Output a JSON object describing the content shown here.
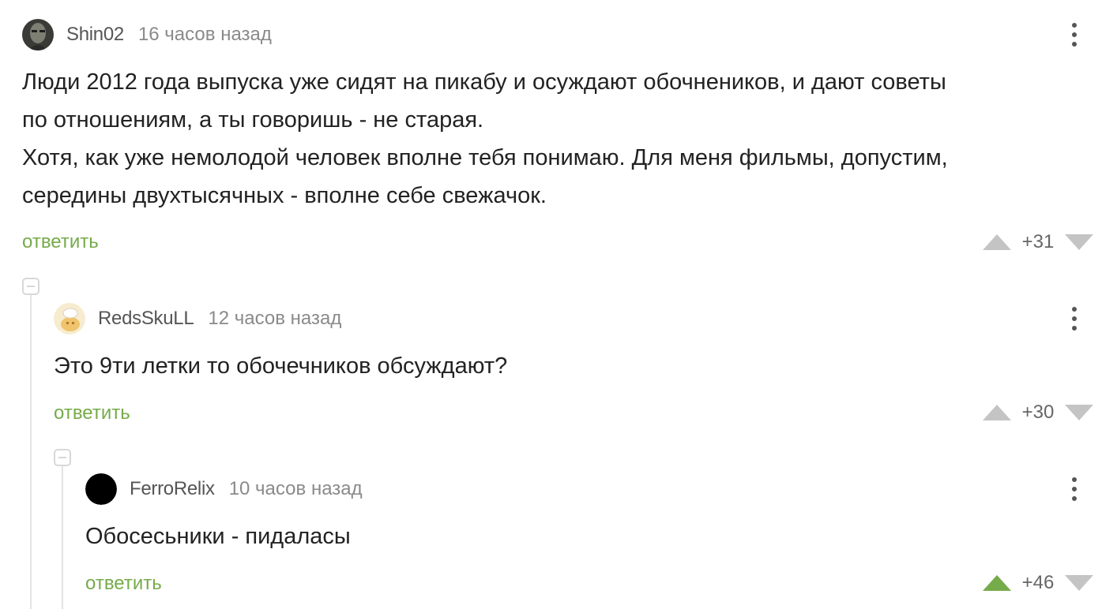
{
  "comments": [
    {
      "username": "Shin02",
      "time": "16 часов назад",
      "lines": [
        "Люди 2012 года выпуска уже сидят на пикабу и осуждают обочнеников, и дают советы",
        "по отношениям, а ты говоришь - не старая.",
        "Хотя, как уже немолодой человек вполне тебя понимаю. Для меня фильмы, допустим,",
        "середины двухтысячных - вполне себе свежачок."
      ],
      "reply_label": "ответить",
      "score": "+31",
      "upvoted": false
    },
    {
      "username": "RedsSkuLL",
      "time": "12 часов назад",
      "lines": [
        "Это 9ти летки то обочечников обсуждают?"
      ],
      "reply_label": "ответить",
      "score": "+30",
      "upvoted": false
    },
    {
      "username": "FerroRelix",
      "time": "10 часов назад",
      "lines": [
        "Обосесьники - пидаласы"
      ],
      "reply_label": "ответить",
      "score": "+46",
      "upvoted": true
    }
  ],
  "colors": {
    "accent_green": "#76ab4a",
    "arrow_gray": "#c4c4c4",
    "text": "#222222",
    "muted": "#8a8a8a"
  }
}
